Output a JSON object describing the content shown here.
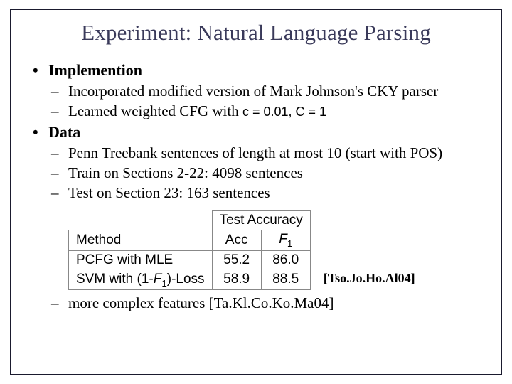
{
  "title": "Experiment: Natural Language Parsing",
  "bullets": {
    "impl": {
      "label": "Implemention",
      "sub1": "Incorporated modified version of Mark Johnson's CKY parser",
      "sub2_prefix": "Learned weighted CFG with ",
      "sub2_formula": "c = 0.01, C = 1"
    },
    "data": {
      "label": "Data",
      "sub1": "Penn Treebank sentences of length at most 10 (start with POS)",
      "sub2": "Train on Sections 2-22: 4098 sentences",
      "sub3": "Test on Section 23: 163 sentences"
    }
  },
  "table": {
    "header_group": "Test Accuracy",
    "col_method": "Method",
    "col_acc": "Acc",
    "col_f1_label": "F",
    "col_f1_sub": "1",
    "rows": [
      {
        "method": "PCFG with MLE",
        "acc": "55.2",
        "f1": "86.0"
      },
      {
        "method_prefix": "SVM with (1-",
        "method_suffix": ")-Loss",
        "acc": "58.9",
        "f1": "88.5"
      }
    ]
  },
  "citation": "[Tso.Jo.Ho.Al04]",
  "footer_line": "more complex features [Ta.Kl.Co.Ko.Ma04]"
}
